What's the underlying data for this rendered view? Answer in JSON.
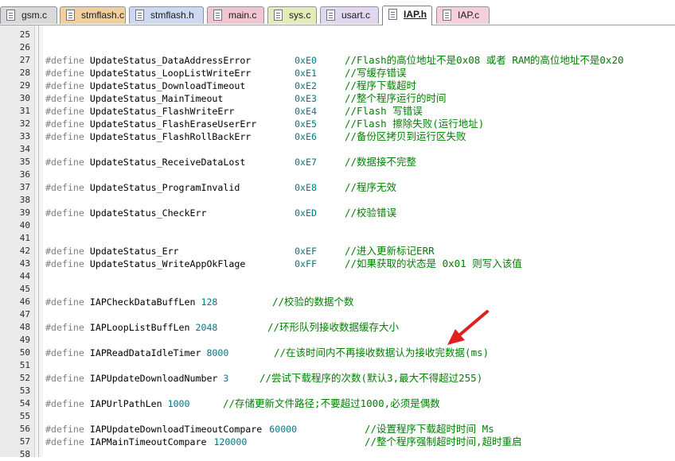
{
  "tabs": [
    {
      "label": "gsm.c",
      "color": "#d9d9d9",
      "active": false
    },
    {
      "label": "stmflash.c",
      "color": "#f2cfa0",
      "active": false
    },
    {
      "label": "stmflash.h",
      "color": "#cdd9f0",
      "active": false
    },
    {
      "label": "main.c",
      "color": "#f2c6d0",
      "active": false
    },
    {
      "label": "sys.c",
      "color": "#e3ecb8",
      "active": false
    },
    {
      "label": "usart.c",
      "color": "#e1d8f0",
      "active": false
    },
    {
      "label": "IAP.h",
      "color": "#ffffff",
      "active": true
    },
    {
      "label": "IAP.c",
      "color": "#f5d0dc",
      "active": false
    }
  ],
  "lines": [
    {
      "n": "25"
    },
    {
      "n": "26"
    },
    {
      "n": "27",
      "kw": "#define",
      "name": "UpdateStatus_DataAddressError",
      "val": "0xE0",
      "cmt": "//Flash的高位地址不是0x08 或者 RAM的高位地址不是0x20"
    },
    {
      "n": "28",
      "kw": "#define",
      "name": "UpdateStatus_LoopListWriteErr",
      "val": "0xE1",
      "cmt": "//写缓存错误"
    },
    {
      "n": "29",
      "kw": "#define",
      "name": "UpdateStatus_DownloadTimeout",
      "val": "0xE2",
      "cmt": "//程序下载超时"
    },
    {
      "n": "30",
      "kw": "#define",
      "name": "UpdateStatus_MainTimeout",
      "val": "0xE3",
      "cmt": "//整个程序运行的时间"
    },
    {
      "n": "31",
      "kw": "#define",
      "name": "UpdateStatus_FlashWriteErr",
      "val": "0xE4",
      "cmt": "//Flash 写错误"
    },
    {
      "n": "32",
      "kw": "#define",
      "name": "UpdateStatus_FlashEraseUserErr",
      "val": "0xE5",
      "cmt": "//Flash 擦除失败(运行地址)"
    },
    {
      "n": "33",
      "kw": "#define",
      "name": "UpdateStatus_FlashRollBackErr",
      "val": "0xE6",
      "cmt": "//备份区拷贝到运行区失败"
    },
    {
      "n": "34"
    },
    {
      "n": "35",
      "kw": "#define",
      "name": "UpdateStatus_ReceiveDataLost",
      "val": "0xE7",
      "cmt": "//数据接不完整"
    },
    {
      "n": "36"
    },
    {
      "n": "37",
      "kw": "#define",
      "name": "UpdateStatus_ProgramInvalid",
      "val": "0xE8",
      "cmt": "//程序无效"
    },
    {
      "n": "38"
    },
    {
      "n": "39",
      "kw": "#define",
      "name": "UpdateStatus_CheckErr",
      "val": "0xED",
      "cmt": "//校验错误"
    },
    {
      "n": "40"
    },
    {
      "n": "41"
    },
    {
      "n": "42",
      "kw": "#define",
      "name": "UpdateStatus_Err",
      "val": "0xEF",
      "cmt": "//进入更新标记ERR"
    },
    {
      "n": "43",
      "kw": "#define",
      "name": "UpdateStatus_WriteAppOkFlage",
      "val": "0xFF",
      "cmt": "//如果获取的状态是 0x01 则写入该值"
    },
    {
      "n": "44"
    },
    {
      "n": "45"
    },
    {
      "n": "46",
      "kw": "#define",
      "name": "IAPCheckDataBuffLen",
      "val": "128",
      "cmt": "//校验的数据个数"
    },
    {
      "n": "47"
    },
    {
      "n": "48",
      "kw": "#define",
      "name": "IAPLoopListBuffLen",
      "val": "2048",
      "cmt": "//环形队列接收数据缓存大小"
    },
    {
      "n": "49"
    },
    {
      "n": "50",
      "kw": "#define",
      "name": "IAPReadDataIdleTimer",
      "val": "8000",
      "cmt": "//在该时间内不再接收数据认为接收完数据(ms)"
    },
    {
      "n": "51"
    },
    {
      "n": "52",
      "kw": "#define",
      "name": "IAPUpdateDownloadNumber",
      "val": "3",
      "cmt": "//尝试下载程序的次数(默认3,最大不得超过255)"
    },
    {
      "n": "53"
    },
    {
      "n": "54",
      "kw": "#define",
      "name": "IAPUrlPathLen",
      "val": "1000",
      "cmt": "//存储更新文件路径;不要超过1000,必须是偶数"
    },
    {
      "n": "55"
    },
    {
      "n": "56",
      "kw": "#define",
      "name": "IAPUpdateDownloadTimeoutCompare",
      "val": "60000",
      "cmt": "//设置程序下载超时时间 Ms"
    },
    {
      "n": "57",
      "kw": "#define",
      "name": "IAPMainTimeoutCompare",
      "val": "120000",
      "cmt": "//整个程序强制超时时间,超时重启"
    },
    {
      "n": "58"
    }
  ],
  "colors": {
    "keyword": "#808080",
    "value": "#007a80",
    "comment": "#008000",
    "arrow": "#e02020"
  }
}
